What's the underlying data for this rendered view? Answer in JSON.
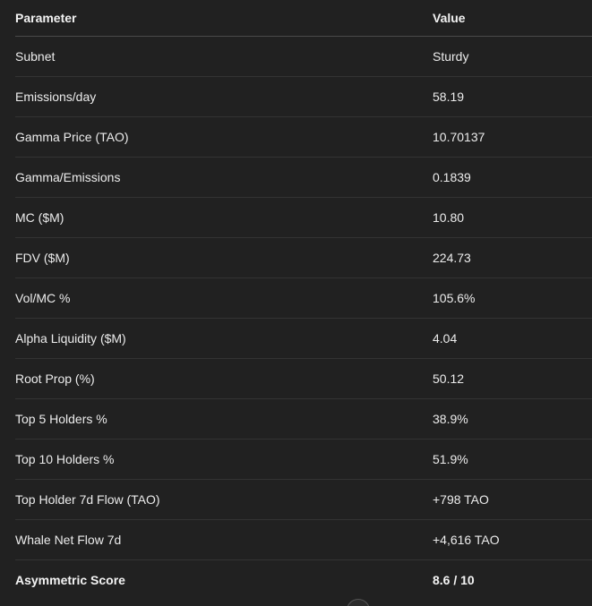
{
  "table": {
    "headers": [
      "Parameter",
      "Value"
    ],
    "rows": [
      [
        "Subnet",
        "Sturdy"
      ],
      [
        "Emissions/day",
        "58.19"
      ],
      [
        "Gamma Price (TAO)",
        "10.70137"
      ],
      [
        "Gamma/Emissions",
        "0.1839"
      ],
      [
        "MC ($M)",
        "10.80"
      ],
      [
        "FDV ($M)",
        "224.73"
      ],
      [
        "Vol/MC %",
        "105.6%"
      ],
      [
        "Alpha Liquidity ($M)",
        "4.04"
      ],
      [
        "Root Prop (%)",
        "50.12"
      ],
      [
        "Top 5 Holders %",
        "38.9%"
      ],
      [
        "Top 10 Holders %",
        "51.9%"
      ],
      [
        "Top Holder 7d Flow (TAO)",
        "+798 TAO"
      ],
      [
        "Whale Net Flow 7d",
        "+4,616 TAO"
      ],
      [
        "Asymmetric Score",
        "8.6 / 10"
      ]
    ]
  }
}
